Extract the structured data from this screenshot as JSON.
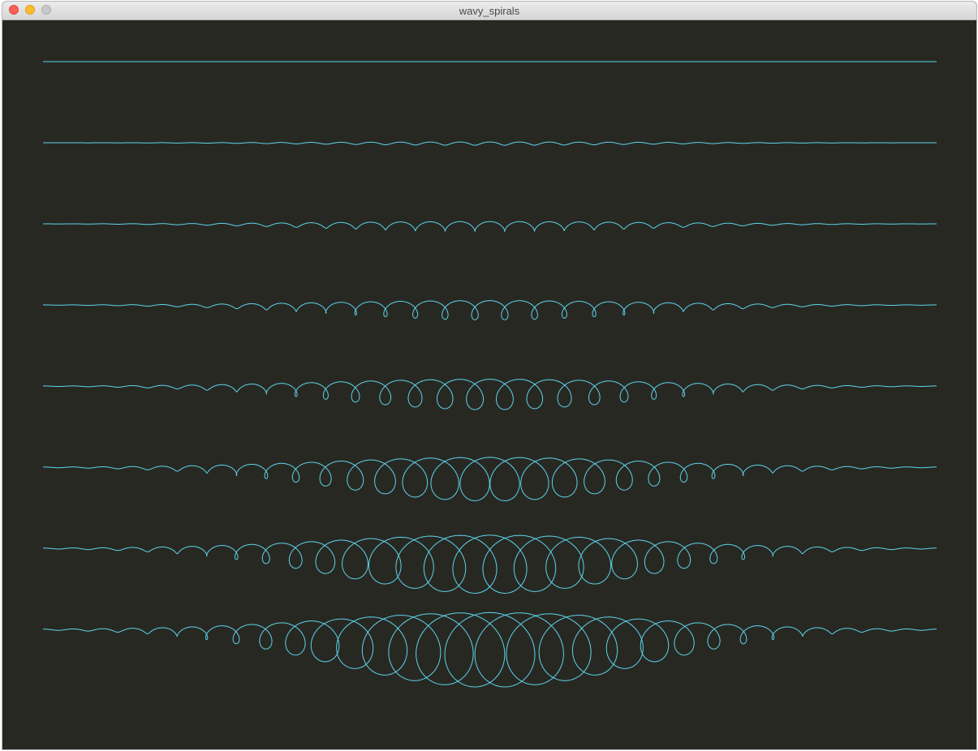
{
  "window": {
    "title": "wavy_spirals"
  },
  "colors": {
    "background": "#282823",
    "stroke": "#5dd4ea"
  },
  "icons": {
    "close": "close-icon",
    "minimize": "minimize-icon",
    "zoom": "zoom-icon"
  }
}
